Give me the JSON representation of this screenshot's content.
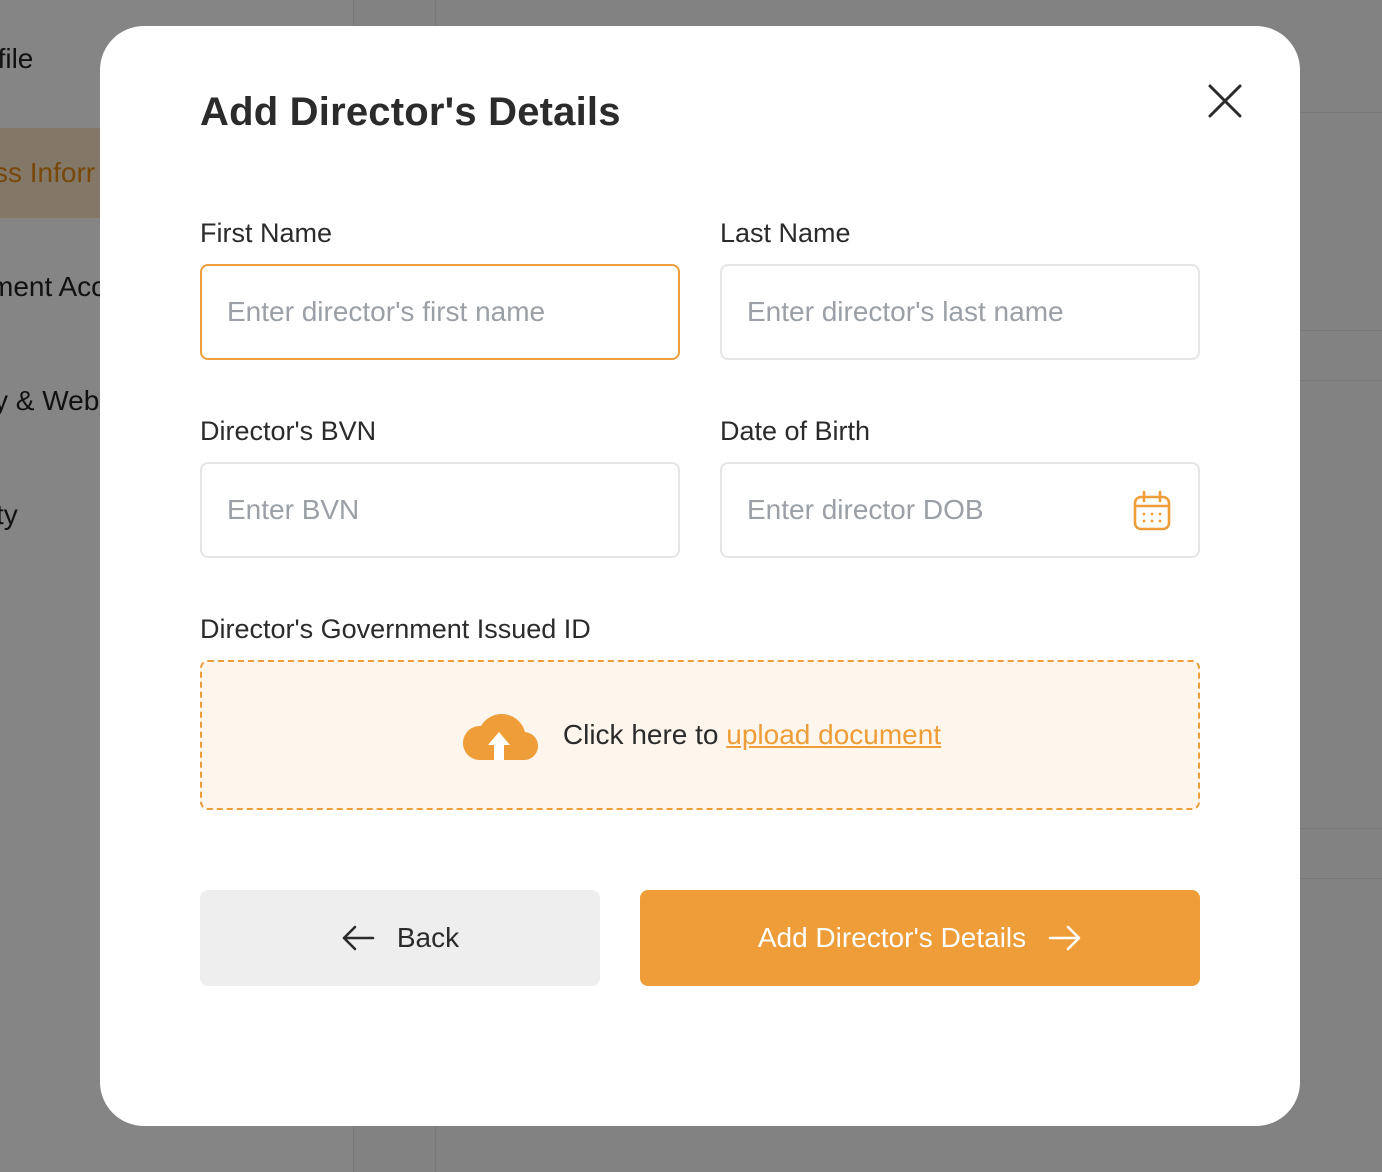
{
  "background": {
    "sidebar_items": [
      {
        "label": "Business Profile",
        "visible_fragment": "ofile"
      },
      {
        "label": "Business Information",
        "visible_fragment": "ss Inforr",
        "active": true
      },
      {
        "label": "Settlement Account",
        "visible_fragment": "ment Acc"
      },
      {
        "label": "Social Media & Website",
        "visible_fragment": "y & Web"
      },
      {
        "label": "Security",
        "visible_fragment": "ty"
      }
    ]
  },
  "modal": {
    "title": "Add Director's Details",
    "close_icon": "close-icon",
    "fields": {
      "first_name": {
        "label": "First Name",
        "placeholder": "Enter director's first name",
        "value": ""
      },
      "last_name": {
        "label": "Last Name",
        "placeholder": "Enter director's last name",
        "value": ""
      },
      "bvn": {
        "label": "Director's BVN",
        "placeholder": "Enter BVN",
        "value": ""
      },
      "dob": {
        "label": "Date of Birth",
        "placeholder": "Enter director DOB",
        "value": "",
        "icon": "calendar-icon"
      }
    },
    "upload": {
      "label": "Director's Government Issued ID",
      "prefix_text": "Click here to ",
      "link_text": "upload document",
      "icon": "cloud-upload-icon"
    },
    "buttons": {
      "back_label": "Back",
      "submit_label": "Add Director's Details"
    }
  },
  "colors": {
    "accent": "#EE9D38",
    "upload_bg": "#FEF6EC",
    "back_button_bg": "#EEEEEE",
    "text": "#2B2B2B",
    "placeholder": "#9AA0A6"
  }
}
